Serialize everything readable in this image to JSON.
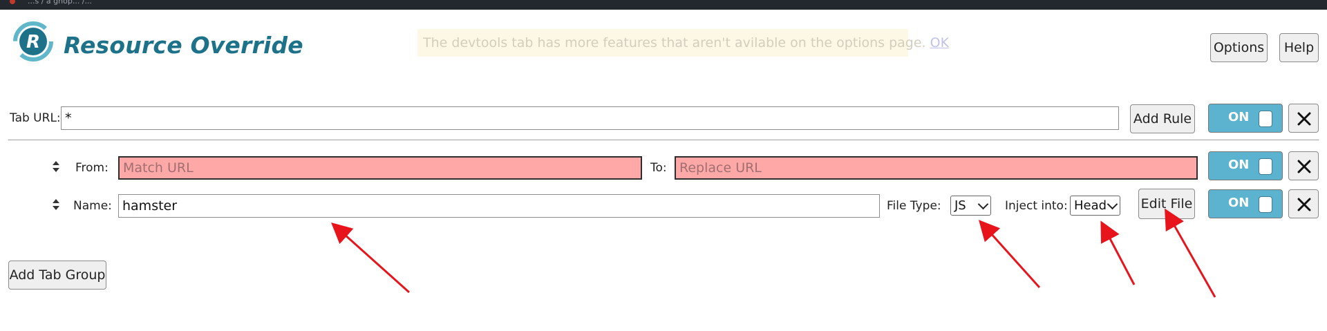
{
  "browser_tab": {
    "title": "...s / a gnop... /..."
  },
  "header": {
    "title": "Resource Override",
    "notice_text": "The devtools tab has more features that aren't avilable on the options page.",
    "notice_link": "OK",
    "options_label": "Options",
    "help_label": "Help"
  },
  "tab_group": {
    "tab_url_label": "Tab URL:",
    "tab_url_value": "*",
    "add_rule_label": "Add Rule",
    "toggle_label": "ON",
    "rules": [
      {
        "from_label": "From:",
        "from_placeholder": "Match URL",
        "to_label": "To:",
        "to_placeholder": "Replace URL",
        "toggle_label": "ON"
      },
      {
        "name_label": "Name:",
        "name_value": "hamster",
        "file_type_label": "File Type:",
        "file_type_value": "JS",
        "inject_label": "Inject into:",
        "inject_value": "Head",
        "edit_file_label": "Edit File",
        "toggle_label": "ON"
      }
    ]
  },
  "add_tab_group_label": "Add Tab Group",
  "colors": {
    "brand": "#1d7289",
    "toggle_on": "#5bb3d0",
    "invalid_field": "#ffa8a8",
    "annotation_arrow": "#e8141c"
  },
  "icons": [
    "logo-r-icon",
    "close-icon",
    "drag-handle-icon",
    "chevron-down-icon"
  ]
}
